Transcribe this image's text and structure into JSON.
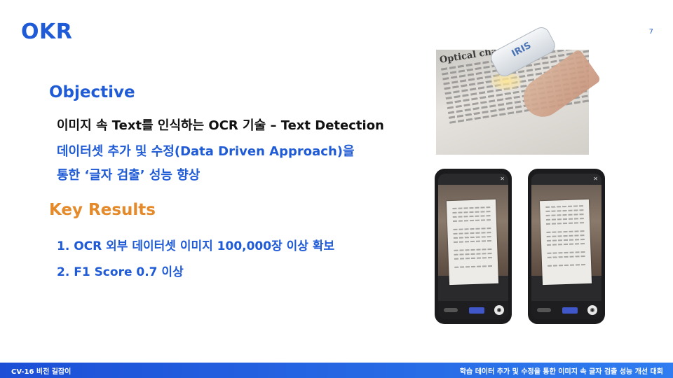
{
  "slide": {
    "title": "OKR",
    "page_number": "7"
  },
  "objective": {
    "heading": "Objective",
    "lines": [
      "이미지 속 Text를 인식하는 OCR 기술 – Text Detection",
      "데이터셋 추가 및 수정(Data Driven Approach)을",
      "통한 ‘글자 검출’ 성능 향상"
    ]
  },
  "key_results": {
    "heading": "Key Results",
    "items": [
      "1. OCR 외부 데이터셋 이미지 100,000장 이상 확보",
      "2. F1 Score 0.7 이상"
    ]
  },
  "ocr_photo": {
    "doc_heading": "Optical chara",
    "scanner_label": "IRIS"
  },
  "footer": {
    "left": "CV-16 비전 길잡이",
    "right": "학습 데이터 추가 및 수정을 통한 이미지 속 글자 검출 성능 개선 대회"
  },
  "colors": {
    "accent_blue": "#1f5bd6",
    "key_results_orange": "#e48a2a"
  }
}
